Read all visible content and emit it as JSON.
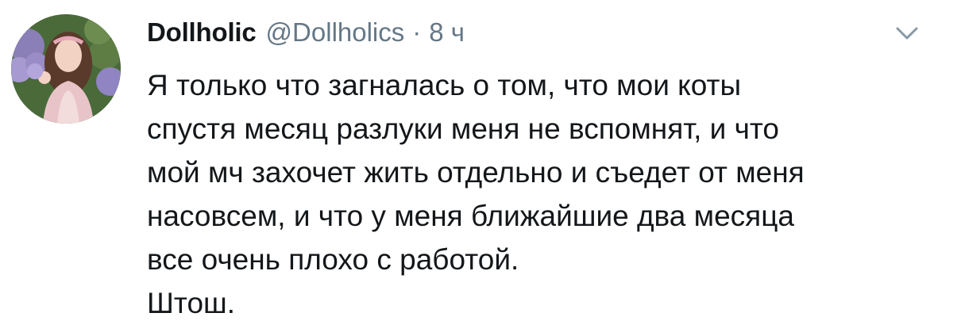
{
  "tweet": {
    "author": {
      "display_name": "Dollholic",
      "handle": "@Dollholics"
    },
    "separator": "·",
    "time": "8 ч",
    "text_lines": [
      "Я только что загналась о том, что мои коты",
      "спустя месяц разлуки меня не вспомнят, и что",
      "мой мч захочет жить отдельно и съедет от меня",
      "насовсем, и что у меня ближайшие два месяца",
      "все очень плохо с работой.",
      "Штош."
    ],
    "menu_icon": "chevron-down-icon",
    "avatar_icon": "avatar"
  }
}
